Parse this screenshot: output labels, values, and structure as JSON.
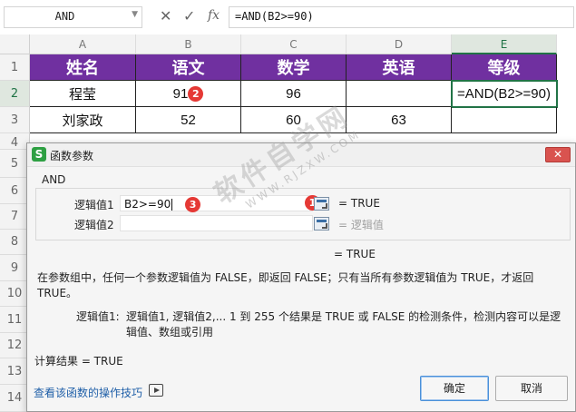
{
  "formula_bar": {
    "name_box": "AND",
    "cancel_icon": "close-icon",
    "enter_icon": "check-icon",
    "fx_label": "fx",
    "formula": "=AND(B2>=90)"
  },
  "sheet": {
    "columns": [
      "A",
      "B",
      "C",
      "D",
      "E"
    ],
    "rows": [
      "1",
      "2",
      "3",
      "4",
      "5",
      "6",
      "7",
      "8",
      "9",
      "10",
      "11",
      "12",
      "13",
      "14"
    ],
    "header_row": [
      "姓名",
      "语文",
      "数学",
      "英语",
      "等级"
    ],
    "row2": [
      "程莹",
      "91",
      "96",
      "",
      "=AND(B2>=90)"
    ],
    "row3": [
      "刘家政",
      "52",
      "60",
      "63",
      ""
    ],
    "header_fill": "#7030a0",
    "selected_border": "#217346"
  },
  "badges": [
    "2",
    "3",
    "1"
  ],
  "dialog": {
    "app_icon": "S",
    "title": "函数参数",
    "function_name": "AND",
    "arg1_label": "逻辑值1",
    "arg1_value": "B2>=90",
    "arg1_result": "= TRUE",
    "arg2_label": "逻辑值2",
    "arg2_value": "",
    "arg2_result": "= 逻辑值",
    "overall_result": "= TRUE",
    "description": "在参数组中，任何一个参数逻辑值为 FALSE，即返回 FALSE；只有当所有参数逻辑值为 TRUE，才返回 TRUE。",
    "param_label": "逻辑值1:",
    "param_desc": "逻辑值1, 逻辑值2,... 1 到 255 个结果是 TRUE 或 FALSE 的检测条件，检测内容可以是逻辑值、数组或引用",
    "calc_result": "计算结果 = TRUE",
    "help_link": "查看该函数的操作技巧",
    "ok_label": "确定",
    "cancel_label": "取消",
    "close_label": "✕"
  },
  "watermark": {
    "main": "软件自学网",
    "sub": "WWW.RJZXW.COM"
  }
}
